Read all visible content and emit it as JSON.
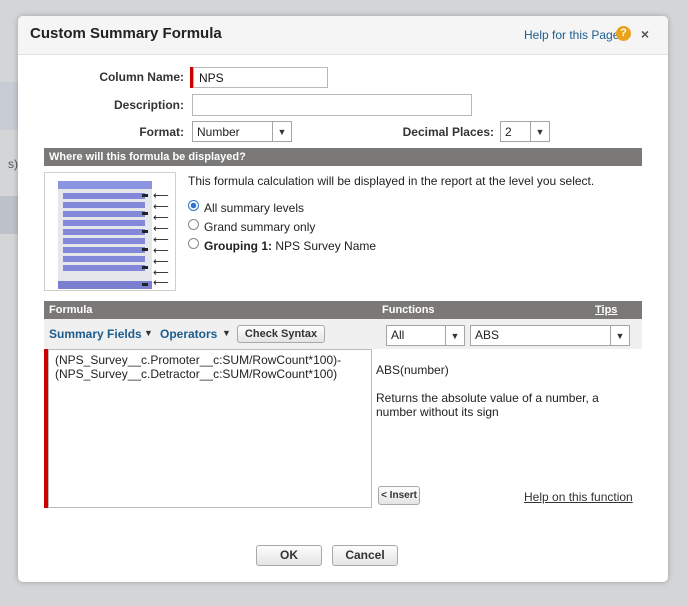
{
  "background": {
    "partial_text": "s)"
  },
  "dialog": {
    "title": "Custom Summary Formula",
    "help_link": "Help for this Page",
    "help_icon": "?",
    "close_icon": "×"
  },
  "form": {
    "column_name_label": "Column Name:",
    "column_name_value": "NPS",
    "description_label": "Description:",
    "description_value": "",
    "format_label": "Format:",
    "format_value": "Number",
    "decimal_label": "Decimal Places:",
    "decimal_value": "2"
  },
  "display": {
    "header": "Where will this formula be displayed?",
    "description": "This formula calculation will be displayed in the report at the level you select.",
    "options": [
      {
        "label": "All summary levels",
        "selected": true
      },
      {
        "label": "Grand summary only",
        "selected": false
      },
      {
        "bold_prefix": "Grouping 1:",
        "label": "NPS Survey Name",
        "selected": false
      }
    ]
  },
  "formula": {
    "header_formula": "Formula",
    "header_functions": "Functions",
    "header_tips": "Tips",
    "summary_fields": "Summary Fields",
    "operators": "Operators",
    "check_syntax": "Check Syntax",
    "function_category": "All",
    "function_selected": "ABS",
    "text": "(NPS_Survey__c.Promoter__c:SUM/RowCount*100)-\n(NPS_Survey__c.Detractor__c:SUM/RowCount*100)",
    "function_signature": "ABS(number)",
    "function_description": "Returns the absolute value of a number, a number without its sign",
    "insert_button": "< Insert",
    "help_function": "Help on this function"
  },
  "buttons": {
    "ok": "OK",
    "cancel": "Cancel"
  },
  "colors": {
    "link": "#1d5d8e",
    "required": "#cc0000",
    "section_header": "#7b7977",
    "help_icon": "#e8a21c"
  }
}
